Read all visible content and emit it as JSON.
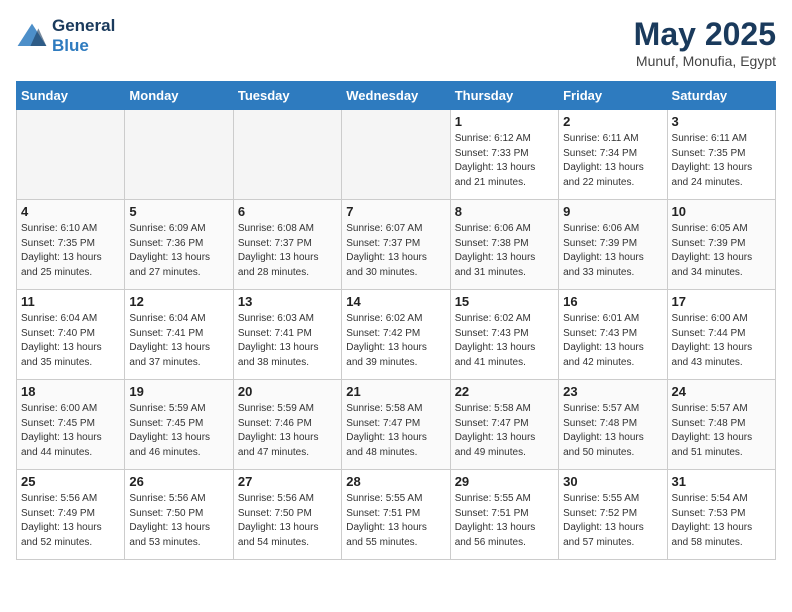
{
  "header": {
    "logo_line1": "General",
    "logo_line2": "Blue",
    "month": "May 2025",
    "location": "Munuf, Monufia, Egypt"
  },
  "weekdays": [
    "Sunday",
    "Monday",
    "Tuesday",
    "Wednesday",
    "Thursday",
    "Friday",
    "Saturday"
  ],
  "weeks": [
    [
      {
        "day": "",
        "info": "",
        "empty": true
      },
      {
        "day": "",
        "info": "",
        "empty": true
      },
      {
        "day": "",
        "info": "",
        "empty": true
      },
      {
        "day": "",
        "info": "",
        "empty": true
      },
      {
        "day": "1",
        "info": "Sunrise: 6:12 AM\nSunset: 7:33 PM\nDaylight: 13 hours\nand 21 minutes.",
        "empty": false
      },
      {
        "day": "2",
        "info": "Sunrise: 6:11 AM\nSunset: 7:34 PM\nDaylight: 13 hours\nand 22 minutes.",
        "empty": false
      },
      {
        "day": "3",
        "info": "Sunrise: 6:11 AM\nSunset: 7:35 PM\nDaylight: 13 hours\nand 24 minutes.",
        "empty": false
      }
    ],
    [
      {
        "day": "4",
        "info": "Sunrise: 6:10 AM\nSunset: 7:35 PM\nDaylight: 13 hours\nand 25 minutes.",
        "empty": false
      },
      {
        "day": "5",
        "info": "Sunrise: 6:09 AM\nSunset: 7:36 PM\nDaylight: 13 hours\nand 27 minutes.",
        "empty": false
      },
      {
        "day": "6",
        "info": "Sunrise: 6:08 AM\nSunset: 7:37 PM\nDaylight: 13 hours\nand 28 minutes.",
        "empty": false
      },
      {
        "day": "7",
        "info": "Sunrise: 6:07 AM\nSunset: 7:37 PM\nDaylight: 13 hours\nand 30 minutes.",
        "empty": false
      },
      {
        "day": "8",
        "info": "Sunrise: 6:06 AM\nSunset: 7:38 PM\nDaylight: 13 hours\nand 31 minutes.",
        "empty": false
      },
      {
        "day": "9",
        "info": "Sunrise: 6:06 AM\nSunset: 7:39 PM\nDaylight: 13 hours\nand 33 minutes.",
        "empty": false
      },
      {
        "day": "10",
        "info": "Sunrise: 6:05 AM\nSunset: 7:39 PM\nDaylight: 13 hours\nand 34 minutes.",
        "empty": false
      }
    ],
    [
      {
        "day": "11",
        "info": "Sunrise: 6:04 AM\nSunset: 7:40 PM\nDaylight: 13 hours\nand 35 minutes.",
        "empty": false
      },
      {
        "day": "12",
        "info": "Sunrise: 6:04 AM\nSunset: 7:41 PM\nDaylight: 13 hours\nand 37 minutes.",
        "empty": false
      },
      {
        "day": "13",
        "info": "Sunrise: 6:03 AM\nSunset: 7:41 PM\nDaylight: 13 hours\nand 38 minutes.",
        "empty": false
      },
      {
        "day": "14",
        "info": "Sunrise: 6:02 AM\nSunset: 7:42 PM\nDaylight: 13 hours\nand 39 minutes.",
        "empty": false
      },
      {
        "day": "15",
        "info": "Sunrise: 6:02 AM\nSunset: 7:43 PM\nDaylight: 13 hours\nand 41 minutes.",
        "empty": false
      },
      {
        "day": "16",
        "info": "Sunrise: 6:01 AM\nSunset: 7:43 PM\nDaylight: 13 hours\nand 42 minutes.",
        "empty": false
      },
      {
        "day": "17",
        "info": "Sunrise: 6:00 AM\nSunset: 7:44 PM\nDaylight: 13 hours\nand 43 minutes.",
        "empty": false
      }
    ],
    [
      {
        "day": "18",
        "info": "Sunrise: 6:00 AM\nSunset: 7:45 PM\nDaylight: 13 hours\nand 44 minutes.",
        "empty": false
      },
      {
        "day": "19",
        "info": "Sunrise: 5:59 AM\nSunset: 7:45 PM\nDaylight: 13 hours\nand 46 minutes.",
        "empty": false
      },
      {
        "day": "20",
        "info": "Sunrise: 5:59 AM\nSunset: 7:46 PM\nDaylight: 13 hours\nand 47 minutes.",
        "empty": false
      },
      {
        "day": "21",
        "info": "Sunrise: 5:58 AM\nSunset: 7:47 PM\nDaylight: 13 hours\nand 48 minutes.",
        "empty": false
      },
      {
        "day": "22",
        "info": "Sunrise: 5:58 AM\nSunset: 7:47 PM\nDaylight: 13 hours\nand 49 minutes.",
        "empty": false
      },
      {
        "day": "23",
        "info": "Sunrise: 5:57 AM\nSunset: 7:48 PM\nDaylight: 13 hours\nand 50 minutes.",
        "empty": false
      },
      {
        "day": "24",
        "info": "Sunrise: 5:57 AM\nSunset: 7:48 PM\nDaylight: 13 hours\nand 51 minutes.",
        "empty": false
      }
    ],
    [
      {
        "day": "25",
        "info": "Sunrise: 5:56 AM\nSunset: 7:49 PM\nDaylight: 13 hours\nand 52 minutes.",
        "empty": false
      },
      {
        "day": "26",
        "info": "Sunrise: 5:56 AM\nSunset: 7:50 PM\nDaylight: 13 hours\nand 53 minutes.",
        "empty": false
      },
      {
        "day": "27",
        "info": "Sunrise: 5:56 AM\nSunset: 7:50 PM\nDaylight: 13 hours\nand 54 minutes.",
        "empty": false
      },
      {
        "day": "28",
        "info": "Sunrise: 5:55 AM\nSunset: 7:51 PM\nDaylight: 13 hours\nand 55 minutes.",
        "empty": false
      },
      {
        "day": "29",
        "info": "Sunrise: 5:55 AM\nSunset: 7:51 PM\nDaylight: 13 hours\nand 56 minutes.",
        "empty": false
      },
      {
        "day": "30",
        "info": "Sunrise: 5:55 AM\nSunset: 7:52 PM\nDaylight: 13 hours\nand 57 minutes.",
        "empty": false
      },
      {
        "day": "31",
        "info": "Sunrise: 5:54 AM\nSunset: 7:53 PM\nDaylight: 13 hours\nand 58 minutes.",
        "empty": false
      }
    ]
  ]
}
